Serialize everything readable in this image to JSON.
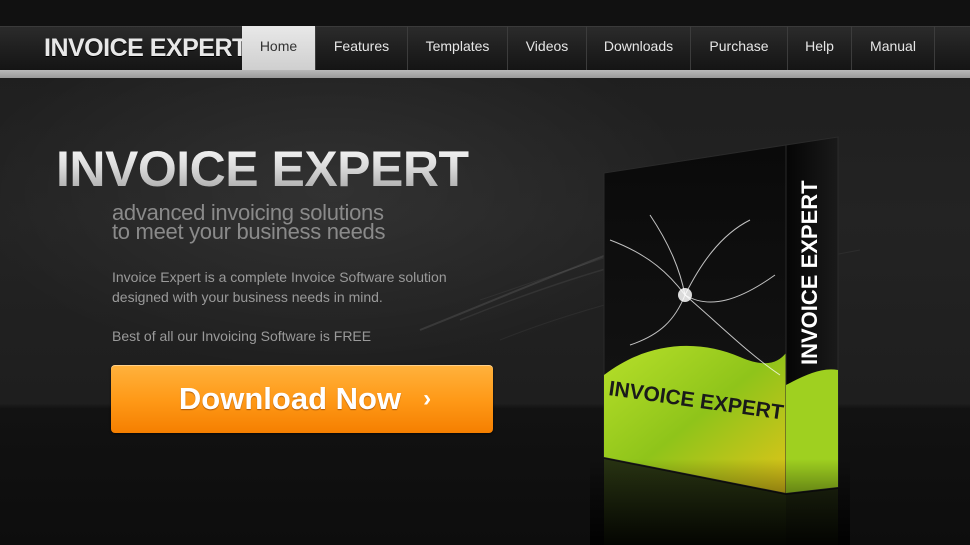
{
  "logo": "INVOICE EXPERT",
  "nav": {
    "items": [
      {
        "label": "Home",
        "active": true
      },
      {
        "label": "Features",
        "active": false
      },
      {
        "label": "Templates",
        "active": false
      },
      {
        "label": "Videos",
        "active": false
      },
      {
        "label": "Downloads",
        "active": false
      },
      {
        "label": "Purchase",
        "active": false
      },
      {
        "label": "Help",
        "active": false
      },
      {
        "label": "Manual",
        "active": false
      }
    ]
  },
  "hero": {
    "title": "INVOICE EXPERT",
    "tagline_line1": "advanced invoicing solutions",
    "tagline_line2": "to meet your business needs",
    "desc_line1": "Invoice Expert is a complete Invoice Software solution",
    "desc_line2": "designed with your business needs in mind.",
    "free_line": "Best of all our Invoicing Software is FREE",
    "download_label": "Download Now",
    "download_icon": "chevron-right-icon"
  },
  "product_box": {
    "front_label": "INVOICE EXPERT",
    "side_label": "INVOICE EXPERT"
  },
  "colors": {
    "accent_orange": "#ff9a18",
    "box_green": "#8fc41a",
    "nav_active": "#d9d9d9"
  }
}
